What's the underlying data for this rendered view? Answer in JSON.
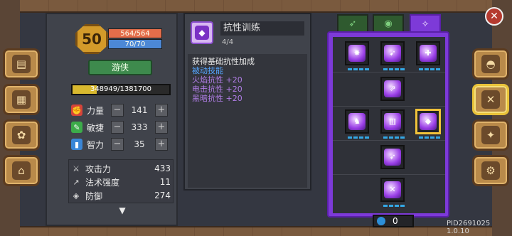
{
  "character": {
    "level": "50",
    "hp": "564/564",
    "mp": "70/70",
    "class_name": "游侠",
    "exp": "348949/1381700",
    "exp_fraction": 0.2525,
    "stats": [
      {
        "label": "力量",
        "value": "141",
        "color": "#d6443a",
        "icon": "fist-icon"
      },
      {
        "label": "敏捷",
        "value": "333",
        "color": "#3cab4a",
        "icon": "feather-icon"
      },
      {
        "label": "智力",
        "value": "35",
        "color": "#3a86d6",
        "icon": "book-icon"
      }
    ],
    "combat": [
      {
        "label": "攻击力",
        "value": "433",
        "icon": "sword-icon"
      },
      {
        "label": "法术强度",
        "value": "11",
        "icon": "wand-icon"
      },
      {
        "label": "防御",
        "value": "274",
        "icon": "shield-icon"
      }
    ]
  },
  "skill_detail": {
    "name": "抗性训练",
    "level": "4/4",
    "description": "获得基础抗性加成",
    "type": "被动技能",
    "effects": [
      "火焰抗性 +20",
      "电击抗性 +20",
      "黑暗抗性 +20"
    ]
  },
  "skill_tree": {
    "points": "0",
    "active_tab_color": "#7d3ad8"
  },
  "version": "PID2691025 1.0.10",
  "left_tabs": [
    "book-icon",
    "map-icon",
    "gear-map-icon",
    "bag-icon"
  ],
  "right_tabs": [
    "helmet-icon",
    "crossed-swords-icon",
    "compass-icon",
    "settings-icon"
  ]
}
